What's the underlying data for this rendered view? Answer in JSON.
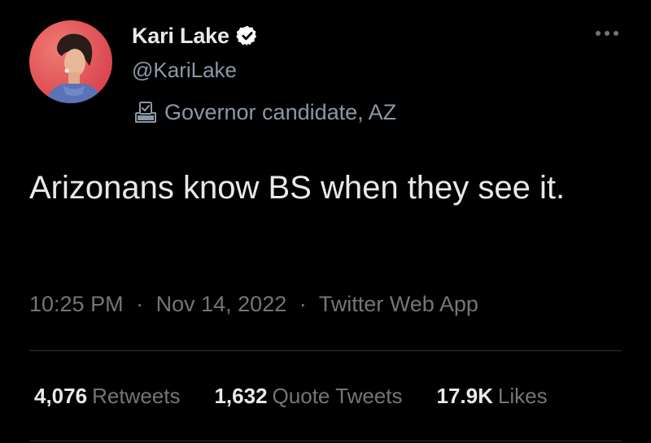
{
  "tweet": {
    "author": {
      "display_name": "Kari Lake",
      "handle": "@KariLake",
      "verified": true,
      "avatar_background": "#e5545c",
      "verified_color": "#ffffff"
    },
    "label": {
      "icon": "ballot-box-icon",
      "text": "Governor candidate, AZ"
    },
    "text": "Arizonans know BS when they see it.",
    "meta": {
      "time": "10:25 PM",
      "separator_1": "·",
      "date": "Nov 14, 2022",
      "separator_2": "·",
      "source": "Twitter Web App"
    },
    "stats": {
      "retweets": {
        "count": "4,076",
        "label": "Retweets"
      },
      "quote_tweets": {
        "count": "1,632",
        "label": "Quote Tweets"
      },
      "likes": {
        "count": "17.9K",
        "label": "Likes"
      }
    },
    "more_icon": "more-horizontal-icon"
  }
}
